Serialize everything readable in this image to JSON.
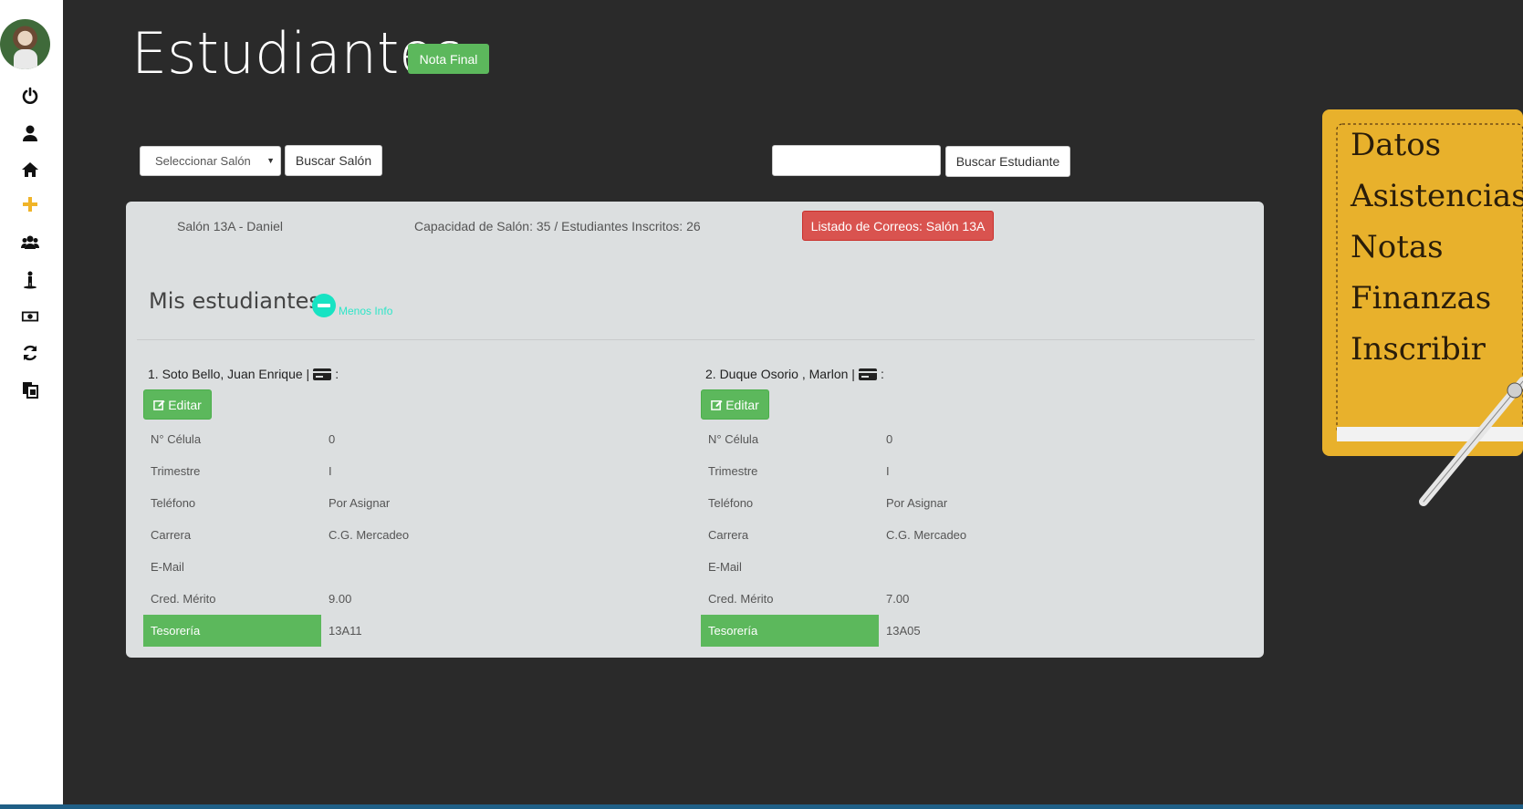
{
  "sidebar": {
    "avatar_alt": "",
    "icons": [
      {
        "name": "power-icon"
      },
      {
        "name": "user-icon"
      },
      {
        "name": "home-icon"
      },
      {
        "name": "plus-icon"
      },
      {
        "name": "users-icon"
      },
      {
        "name": "child-icon"
      },
      {
        "name": "money-icon"
      },
      {
        "name": "refresh-icon"
      },
      {
        "name": "files-icon"
      }
    ],
    "accent_color": "#f0b429"
  },
  "header": {
    "title": "Estudiantes",
    "nota_final_label": "Nota Final"
  },
  "search": {
    "salon_placeholder": "Seleccionar Salón",
    "buscar_salon_label": "Buscar Salón",
    "student_query": "",
    "buscar_estudiante_label": "Buscar Estudiante"
  },
  "panel": {
    "salon_name": "Salón 13A - Daniel",
    "capacity": "Capacidad de Salón: 35 / Estudiantes Inscritos: 26",
    "correos_label": "Listado de Correos: Salón 13A",
    "section_title": "Mis estudiantes",
    "less_info_label": "Menos Info"
  },
  "students": [
    {
      "name": "1. Soto Bello, Juan Enrique |",
      "card_suffix": ":",
      "edit_label": "Editar",
      "fields": [
        {
          "label": "N° Célula",
          "value": "0"
        },
        {
          "label": "Trimestre",
          "value": "I"
        },
        {
          "label": "Teléfono",
          "value": "Por Asignar"
        },
        {
          "label": "Carrera",
          "value": "C.G. Mercadeo"
        },
        {
          "label": "E-Mail",
          "value": ""
        },
        {
          "label": "Cred. Mérito",
          "value": "9.00"
        },
        {
          "label": "Tesorería",
          "value": "13A11"
        }
      ]
    },
    {
      "name": "2. Duque Osorio , Marlon |",
      "card_suffix": ":",
      "edit_label": "Editar",
      "fields": [
        {
          "label": "N° Célula",
          "value": "0"
        },
        {
          "label": "Trimestre",
          "value": "I"
        },
        {
          "label": "Teléfono",
          "value": "Por Asignar"
        },
        {
          "label": "Carrera",
          "value": "C.G. Mercadeo"
        },
        {
          "label": "E-Mail",
          "value": ""
        },
        {
          "label": "Cred. Mérito",
          "value": "7.00"
        },
        {
          "label": "Tesorería",
          "value": "13A05"
        }
      ]
    }
  ],
  "notepad": {
    "items": [
      "Datos",
      "Asistencias",
      "Notas",
      "Finanzas",
      "Inscribir"
    ],
    "color": "#e8b12c"
  },
  "colors": {
    "success": "#5cb85c",
    "danger": "#d9534f",
    "info_teal": "#17e3c3"
  }
}
